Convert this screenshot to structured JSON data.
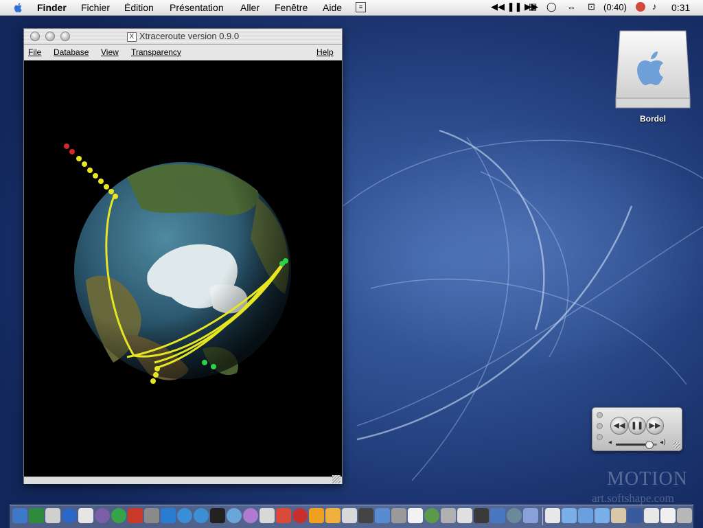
{
  "menubar": {
    "app": "Finder",
    "items": [
      "Fichier",
      "Édition",
      "Présentation",
      "Aller",
      "Fenêtre",
      "Aide"
    ],
    "battery": "(0:40)",
    "clock": "0:31"
  },
  "window": {
    "title": "Xtraceroute version 0.9.0",
    "menu": [
      "File",
      "Database",
      "View",
      "Transparency"
    ],
    "help": "Help"
  },
  "desktop": {
    "disk_label": "Bordel",
    "watermark_line1": "MOTION",
    "watermark_line2": "art.softshape.com"
  },
  "player": {
    "volume": 0.8
  },
  "colors": {
    "route": "#e6e622",
    "node_green": "#2fd24a",
    "node_red": "#d22a2a",
    "node_yellow": "#e8e620"
  }
}
